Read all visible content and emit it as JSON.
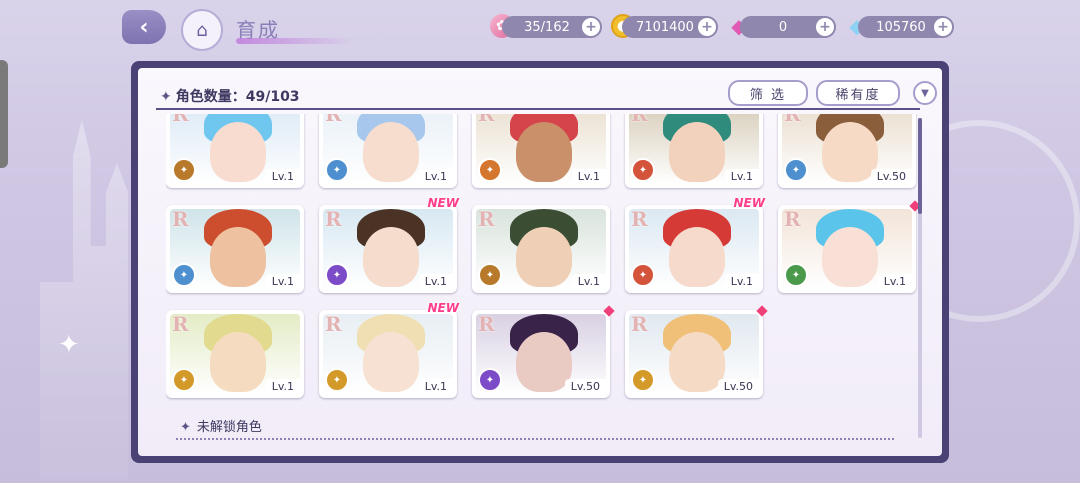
{
  "header": {
    "title": "育成",
    "resources": [
      {
        "name": "candy",
        "icon": "candy-icon",
        "value": "35/162"
      },
      {
        "name": "coin",
        "icon": "coin-icon",
        "value": "7101400"
      },
      {
        "name": "pink-gem",
        "icon": "pink-gem-icon",
        "value": "0"
      },
      {
        "name": "diamond",
        "icon": "diamond-icon",
        "value": "105760"
      }
    ]
  },
  "panel": {
    "count_label": "角色数量：49/103",
    "filter_label": "筛 选",
    "sort_label": "稀有度",
    "locked_label": "未解锁角色"
  },
  "cards": [
    {
      "rank": "R",
      "level": "Lv.1",
      "badge": "",
      "type_color": "#b87a2a",
      "hair": "#6fc7f0",
      "skin": "#f8dcd0",
      "bg": "#dbe9f5"
    },
    {
      "rank": "R",
      "level": "Lv.1",
      "badge": "",
      "type_color": "#4d8fcf",
      "hair": "#a7c8ec",
      "skin": "#f7ddcd",
      "bg": "#e8f0f7"
    },
    {
      "rank": "R",
      "level": "Lv.1",
      "badge": "",
      "type_color": "#d4762d",
      "hair": "#d6444b",
      "skin": "#c9906a",
      "bg": "#e9dfcf"
    },
    {
      "rank": "R",
      "level": "Lv.1",
      "badge": "",
      "type_color": "#d3543a",
      "hair": "#2f8b7c",
      "skin": "#f3d2bd",
      "bg": "#d7cdb9"
    },
    {
      "rank": "R",
      "level": "Lv.50",
      "badge": "",
      "type_color": "#4d8fcf",
      "hair": "#8a5d3b",
      "skin": "#f6dac6",
      "bg": "#e9dccd"
    },
    {
      "rank": "R",
      "level": "Lv.1",
      "badge": "",
      "type_color": "#4d8fcf",
      "hair": "#cc4e2e",
      "skin": "#eec2a1",
      "bg": "#cfe4e9"
    },
    {
      "rank": "R",
      "level": "Lv.1",
      "badge": "NEW",
      "type_color": "#7c4bc8",
      "hair": "#4a3324",
      "skin": "#f5dccc",
      "bg": "#d7e8f2"
    },
    {
      "rank": "R",
      "level": "Lv.1",
      "badge": "",
      "type_color": "#b87a2a",
      "hair": "#3b4e33",
      "skin": "#efcfb6",
      "bg": "#d9e3dd"
    },
    {
      "rank": "R",
      "level": "Lv.1",
      "badge": "NEW",
      "type_color": "#d3543a",
      "hair": "#d53a36",
      "skin": "#f6dacb",
      "bg": "#dbe8f2"
    },
    {
      "rank": "R",
      "level": "Lv.1",
      "badge": "dot",
      "type_color": "#4b9a4b",
      "hair": "#5bc4ea",
      "skin": "#f9e0d6",
      "bg": "#f3e4d8"
    },
    {
      "rank": "R",
      "level": "Lv.1",
      "badge": "",
      "type_color": "#d39a2a",
      "hair": "#e2db8f",
      "skin": "#f5dcc0",
      "bg": "#e3ecc6"
    },
    {
      "rank": "R",
      "level": "Lv.1",
      "badge": "NEW",
      "type_color": "#d39a2a",
      "hair": "#f0dfb2",
      "skin": "#f7e1d2",
      "bg": "#e7eef3"
    },
    {
      "rank": "R",
      "level": "Lv.50",
      "badge": "dot",
      "type_color": "#7c4bc8",
      "hair": "#3a2348",
      "skin": "#e9cbc4",
      "bg": "#d8d0e3"
    },
    {
      "rank": "R",
      "level": "Lv.50",
      "badge": "dot",
      "type_color": "#d39a2a",
      "hair": "#f0c078",
      "skin": "#f5dac6",
      "bg": "#e0e8ef"
    }
  ],
  "colors": {
    "panel_frame": "#4a4174",
    "accent": "#8f87ad",
    "new_badge": "#ff3d8b"
  }
}
